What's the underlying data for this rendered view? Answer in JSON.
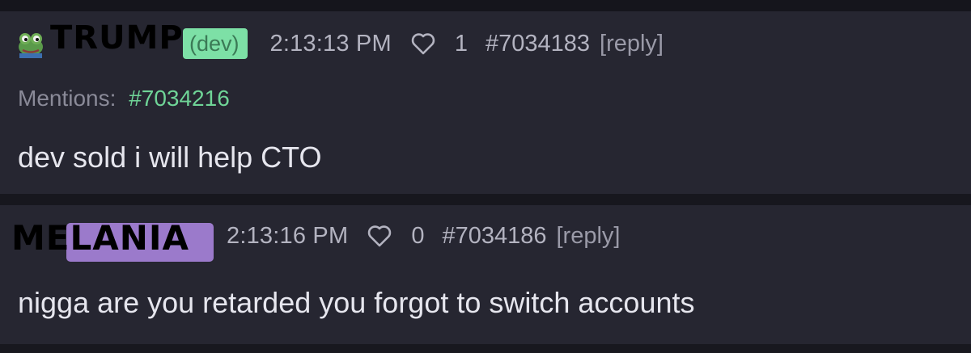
{
  "colors": {
    "background": "#23232d",
    "post_background": "#262631",
    "name_chip_green": "#7de0a6",
    "name_chip_purple": "#b089e6",
    "mention_green": "#6fd497",
    "meta_text": "#b3b3c0",
    "body_text": "#e6e6ee",
    "overlay_text": "#000000"
  },
  "posts": [
    {
      "avatar_icon": "frog-icon",
      "name_tag": "(dev)",
      "time": "2:13:13 PM",
      "like_icon": "heart-icon",
      "like_count": "1",
      "post_number": "#7034183",
      "reply_label": "[reply]",
      "mentions_label": "Mentions:",
      "mentions_ref": "#7034216",
      "body": "dev sold i will help CTO"
    },
    {
      "time": "2:13:16 PM",
      "like_icon": "heart-icon",
      "like_count": "0",
      "post_number": "#7034186",
      "reply_label": "[reply]",
      "body": "nigga are you retarded you forgot to switch accounts"
    }
  ],
  "overlays": {
    "top_label": "TRUMP",
    "bottom_label": "MELANIA"
  }
}
